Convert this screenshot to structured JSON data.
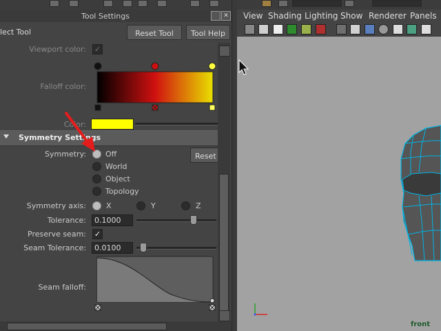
{
  "panel": {
    "title": "Tool Settings",
    "tool_name": "lect Tool",
    "reset_tool": "Reset Tool",
    "tool_help": "Tool Help"
  },
  "attrs": {
    "viewport_color": "Viewport color:",
    "falloff_color": "Falloff color:",
    "color": "Color:",
    "color_value": "#ffff00"
  },
  "symmetry": {
    "section_title": "Symmetry Settings",
    "label": "Symmetry:",
    "reset": "Reset",
    "options": [
      "Off",
      "World",
      "Object",
      "Topology"
    ],
    "selected": "Off",
    "axis_label": "Symmetry axis:",
    "axes": [
      "X",
      "Y",
      "Z"
    ],
    "selected_axis": "X",
    "tolerance_label": "Tolerance:",
    "tolerance_value": "0.1000",
    "tolerance_level": 0.72,
    "preserve_seam_label": "Preserve seam:",
    "preserve_seam": true,
    "seam_tolerance_label": "Seam Tolerance:",
    "seam_tolerance_value": "0.0100",
    "seam_tolerance_level": 0.05,
    "seam_falloff_label": "Seam falloff:"
  },
  "viewport": {
    "menus": [
      "View",
      "Shading",
      "Lighting",
      "Show",
      "Renderer",
      "Panels"
    ],
    "camera": "front",
    "background": "#a2a2a2"
  },
  "icons": [
    "dock-icon",
    "close-icon",
    "expand-triangle-icon",
    "mouse-cursor-icon",
    "axis-gizmo-icon"
  ]
}
